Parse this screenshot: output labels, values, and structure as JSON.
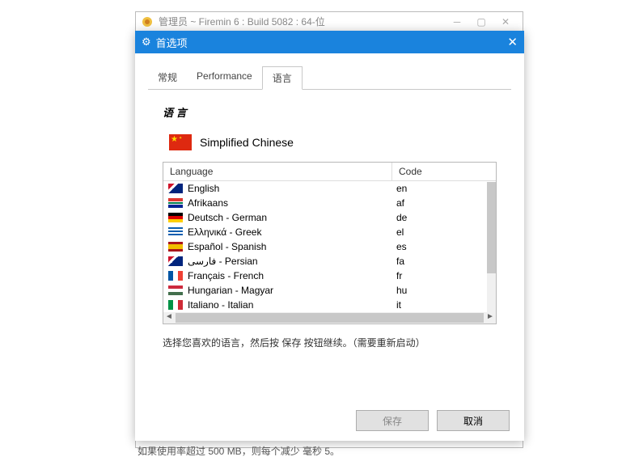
{
  "main_window": {
    "title": "管理员 ~ Firemin 6 : Build 5082 : 64-位"
  },
  "dialog": {
    "title": "首选项"
  },
  "tabs": [
    "常规",
    "Performance",
    "语言"
  ],
  "active_tab": "语言",
  "section_header": "语 言",
  "current_language": "Simplified Chinese",
  "table": {
    "headers": {
      "language": "Language",
      "code": "Code"
    },
    "rows": [
      {
        "flag": "f-uk",
        "name": "English",
        "code": "en"
      },
      {
        "flag": "f-za",
        "name": "Afrikaans",
        "code": "af"
      },
      {
        "flag": "f-de",
        "name": "Deutsch - German",
        "code": "de"
      },
      {
        "flag": "f-gr",
        "name": "Ελληνικά - Greek",
        "code": "el"
      },
      {
        "flag": "f-es",
        "name": "Español - Spanish",
        "code": "es"
      },
      {
        "flag": "f-uk",
        "name": "فارسی - Persian",
        "code": "fa"
      },
      {
        "flag": "f-fr",
        "name": "Français - French",
        "code": "fr"
      },
      {
        "flag": "f-hu",
        "name": "Hungarian - Magyar",
        "code": "hu"
      },
      {
        "flag": "f-it",
        "name": "Italiano - Italian",
        "code": "it"
      }
    ]
  },
  "hint": "选择您喜欢的语言，然后按 保存 按钮继续。（需要重新启动）",
  "buttons": {
    "save": "保存",
    "cancel": "取消"
  },
  "bg_text": "如果使用率超过 500 MB，则每个减少 毫秒 5。"
}
